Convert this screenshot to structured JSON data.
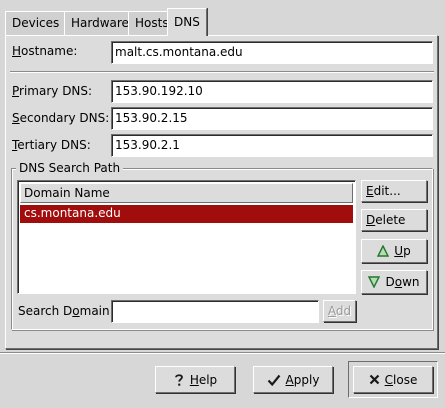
{
  "tabs": [
    {
      "label": "Devices"
    },
    {
      "label": "Hardware"
    },
    {
      "label": "Hosts"
    },
    {
      "label": "DNS"
    }
  ],
  "form": {
    "hostname": {
      "label_pre": "",
      "label_mnemonic": "H",
      "label_post": "ostname:",
      "value": "malt.cs.montana.edu"
    },
    "primary_dns": {
      "label_pre": "",
      "label_mnemonic": "P",
      "label_post": "rimary DNS:",
      "value": "153.90.192.10"
    },
    "secondary_dns": {
      "label_pre": "",
      "label_mnemonic": "S",
      "label_post": "econdary DNS:",
      "value": "153.90.2.15"
    },
    "tertiary_dns": {
      "label_pre": "",
      "label_mnemonic": "T",
      "label_post": "ertiary DNS:",
      "value": "153.90.2.1"
    }
  },
  "search_path": {
    "frame_title": "DNS Search Path",
    "column_header": "Domain Name",
    "domains": [
      "cs.montana.edu"
    ],
    "buttons": {
      "edit": {
        "pre": "",
        "mnemonic": "E",
        "post": "dit..."
      },
      "delete": {
        "pre": "",
        "mnemonic": "D",
        "post": "elete"
      },
      "up": {
        "pre": "",
        "mnemonic": "U",
        "post": "p"
      },
      "down": {
        "pre": "D",
        "mnemonic": "o",
        "post": "wn"
      }
    },
    "search_domain": {
      "label_pre": "Search D",
      "label_mnemonic": "o",
      "label_post": "main:",
      "value": ""
    },
    "add_label": {
      "pre": "",
      "mnemonic": "A",
      "post": "dd"
    }
  },
  "actions": {
    "help": {
      "pre": "",
      "mnemonic": "H",
      "post": "elp"
    },
    "apply": {
      "pre": "",
      "mnemonic": "A",
      "post": "pply"
    },
    "close": {
      "pre": "",
      "mnemonic": "C",
      "post": "lose"
    }
  },
  "colors": {
    "selection": "#a10c0c",
    "arrow_green": "#1f7a2b",
    "help_icon": "#1a1a1a"
  },
  "icons": {
    "up": "triangle-up-icon",
    "down": "triangle-down-icon",
    "help": "question-mark-icon",
    "apply": "check-mark-icon",
    "close": "x-mark-icon"
  }
}
